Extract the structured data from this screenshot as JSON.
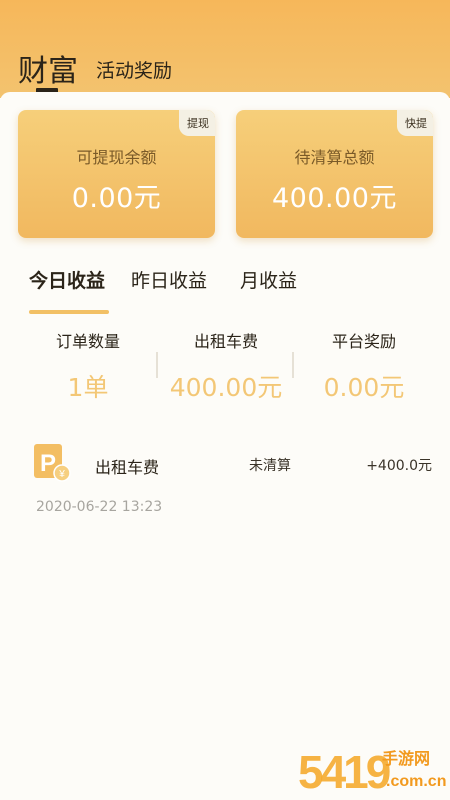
{
  "header": {
    "title": "财富",
    "tab": "活动奖励"
  },
  "cards": [
    {
      "label": "可提现余额",
      "value": "0.00元",
      "badge": "提现"
    },
    {
      "label": "待清算总额",
      "value": "400.00元",
      "badge": "快提"
    }
  ],
  "tabs": [
    "今日收益",
    "昨日收益",
    "月收益"
  ],
  "stats": [
    {
      "label": "订单数量",
      "value": "1单"
    },
    {
      "label": "出租车费",
      "value": "400.00元"
    },
    {
      "label": "平台奖励",
      "value": "0.00元"
    }
  ],
  "transaction": {
    "icon_letter": "P",
    "icon_yen": "¥",
    "name": "出租车费",
    "status": "未清算",
    "amount": "+400.0元",
    "time": "2020-06-22 13:23"
  },
  "watermark": {
    "digits": "5419",
    "text": "手游网",
    "url": ".com.cn"
  },
  "colors": {
    "accent": "#f3b95f",
    "stat_value": "#f3c776",
    "text": "#2b2419"
  }
}
